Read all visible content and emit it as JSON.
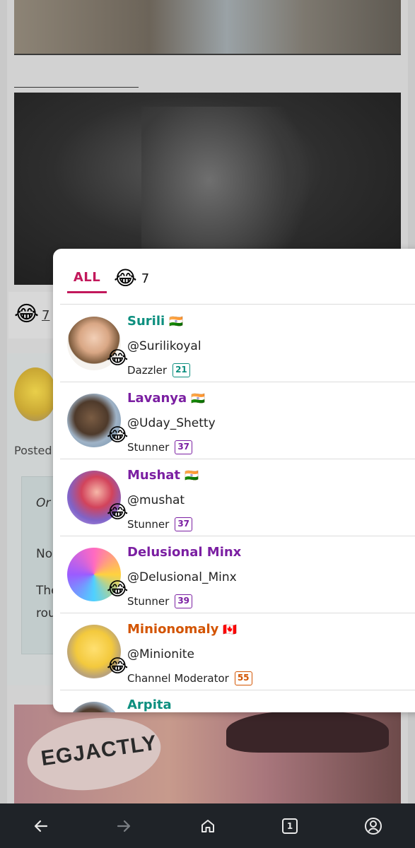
{
  "background": {
    "reaction_emoji": "😂",
    "reaction_count": "7",
    "posted_text": "Posted",
    "quote_line1": "Or",
    "quote_line2": "No",
    "quote_line3": "The",
    "quote_line4": "rou",
    "meme_text": "EGJACTLY"
  },
  "modal": {
    "tabs": {
      "all_label": "ALL",
      "laugh_emoji": "😂",
      "laugh_count": "7"
    },
    "badge_emoji": "😂",
    "users": [
      {
        "name": "Surili",
        "flag": "🇮🇳",
        "handle": "@Surilikoyal",
        "rank": "Dazzler",
        "level": "21",
        "name_color": "#0d8f7f",
        "badge_color": "#0d8f7f"
      },
      {
        "name": "Lavanya",
        "flag": "🇮🇳",
        "handle": "@Uday_Shetty",
        "rank": "Stunner",
        "level": "37",
        "name_color": "#7b1fa2",
        "badge_color": "#7b1fa2"
      },
      {
        "name": "Mushat",
        "flag": "🇮🇳",
        "handle": "@mushat",
        "rank": "Stunner",
        "level": "37",
        "name_color": "#7b1fa2",
        "badge_color": "#7b1fa2"
      },
      {
        "name": "Delusional Minx",
        "flag": "",
        "handle": "@Delusional_Minx",
        "rank": "Stunner",
        "level": "39",
        "name_color": "#7b1fa2",
        "badge_color": "#7b1fa2"
      },
      {
        "name": "Minionomaly",
        "flag": "🇨🇦",
        "handle": "@Minionite",
        "rank": "Channel Moderator",
        "level": "55",
        "name_color": "#d35400",
        "badge_color": "#d35400"
      },
      {
        "name": "Arpita",
        "name_color": "#0d8f7f"
      }
    ]
  },
  "nav": {
    "back_icon": "arrow-left-icon",
    "forward_icon": "arrow-right-icon",
    "home_icon": "home-icon",
    "tabs_count": "1",
    "profile_icon": "account-icon"
  }
}
